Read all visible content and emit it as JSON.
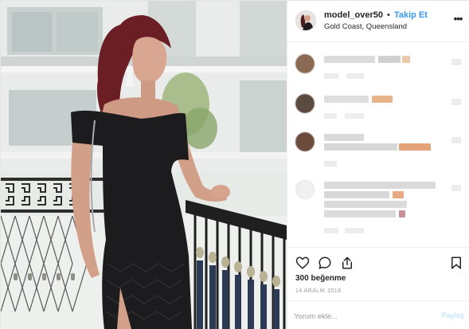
{
  "header": {
    "username": "model_over50",
    "separator": "•",
    "follow_label": "Takip Et",
    "location": "Gold Coast, Queensland",
    "more_icon": "more-dots-icon"
  },
  "photo": {
    "subject": "woman-in-black-dress-on-balcony"
  },
  "comments": {
    "blurred": true,
    "items": [
      {
        "avatar_color": "#8a6a55",
        "bar_a": "#dcdcdc",
        "accent": "#e9c9a9",
        "meta": "#ededed"
      },
      {
        "avatar_color": "#5a4a40",
        "bar_a": "#dedede",
        "accent": "#e7b489",
        "meta": "#eeeeee"
      },
      {
        "avatar_color": "#6b4b3c",
        "bar_a": "#d9d9d9",
        "accent": "#e5a178",
        "meta": "#ececec"
      },
      {
        "avatar_color": "#f0f0f0",
        "bar_a": "#dadada",
        "accent": "#e7a882",
        "meta": "#ededed"
      }
    ]
  },
  "actions": {
    "like_icon": "heart-icon",
    "comment_icon": "comment-bubble-icon",
    "share_icon": "share-icon",
    "save_icon": "bookmark-icon"
  },
  "likes_text": "300 beğenme",
  "date_text": "14 ARALIK 2018",
  "add_comment": {
    "placeholder": "Yorum ekle...",
    "post_label": "Paylaş"
  },
  "colors": {
    "accent_blue": "#3897f0",
    "post_button_disabled": "#b2dffc",
    "border": "#efefef"
  }
}
